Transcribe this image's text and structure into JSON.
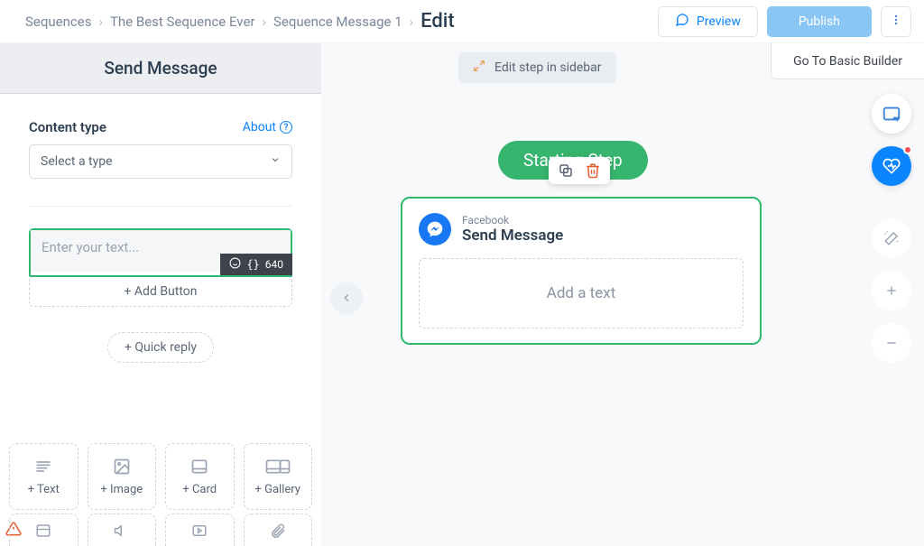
{
  "breadcrumb": {
    "items": [
      "Sequences",
      "The Best Sequence Ever",
      "Sequence Message 1"
    ],
    "current": "Edit"
  },
  "actions": {
    "preview": "Preview",
    "publish": "Publish",
    "basic_builder": "Go To Basic Builder"
  },
  "sidebar": {
    "title": "Send Message",
    "content_type_label": "Content type",
    "about_label": "About",
    "select_placeholder": "Select a type",
    "text_placeholder": "Enter your text...",
    "char_count": "640",
    "add_button": "+ Add Button",
    "quick_reply": "+ Quick reply",
    "types": [
      {
        "label": "+ Text",
        "icon": "text"
      },
      {
        "label": "+ Image",
        "icon": "image"
      },
      {
        "label": "+ Card",
        "icon": "card"
      },
      {
        "label": "+ Gallery",
        "icon": "gallery"
      }
    ],
    "types_row2_icons": [
      "card",
      "audio",
      "video",
      "attach"
    ]
  },
  "canvas": {
    "edit_in_sidebar": "Edit step in sidebar",
    "starting_step": "Starting Step",
    "card": {
      "source": "Facebook",
      "title": "Send Message",
      "placeholder": "Add a text"
    }
  },
  "colors": {
    "accent_green": "#30b770",
    "accent_blue": "#0a84ff",
    "publish_blue": "#8ac6f4"
  }
}
